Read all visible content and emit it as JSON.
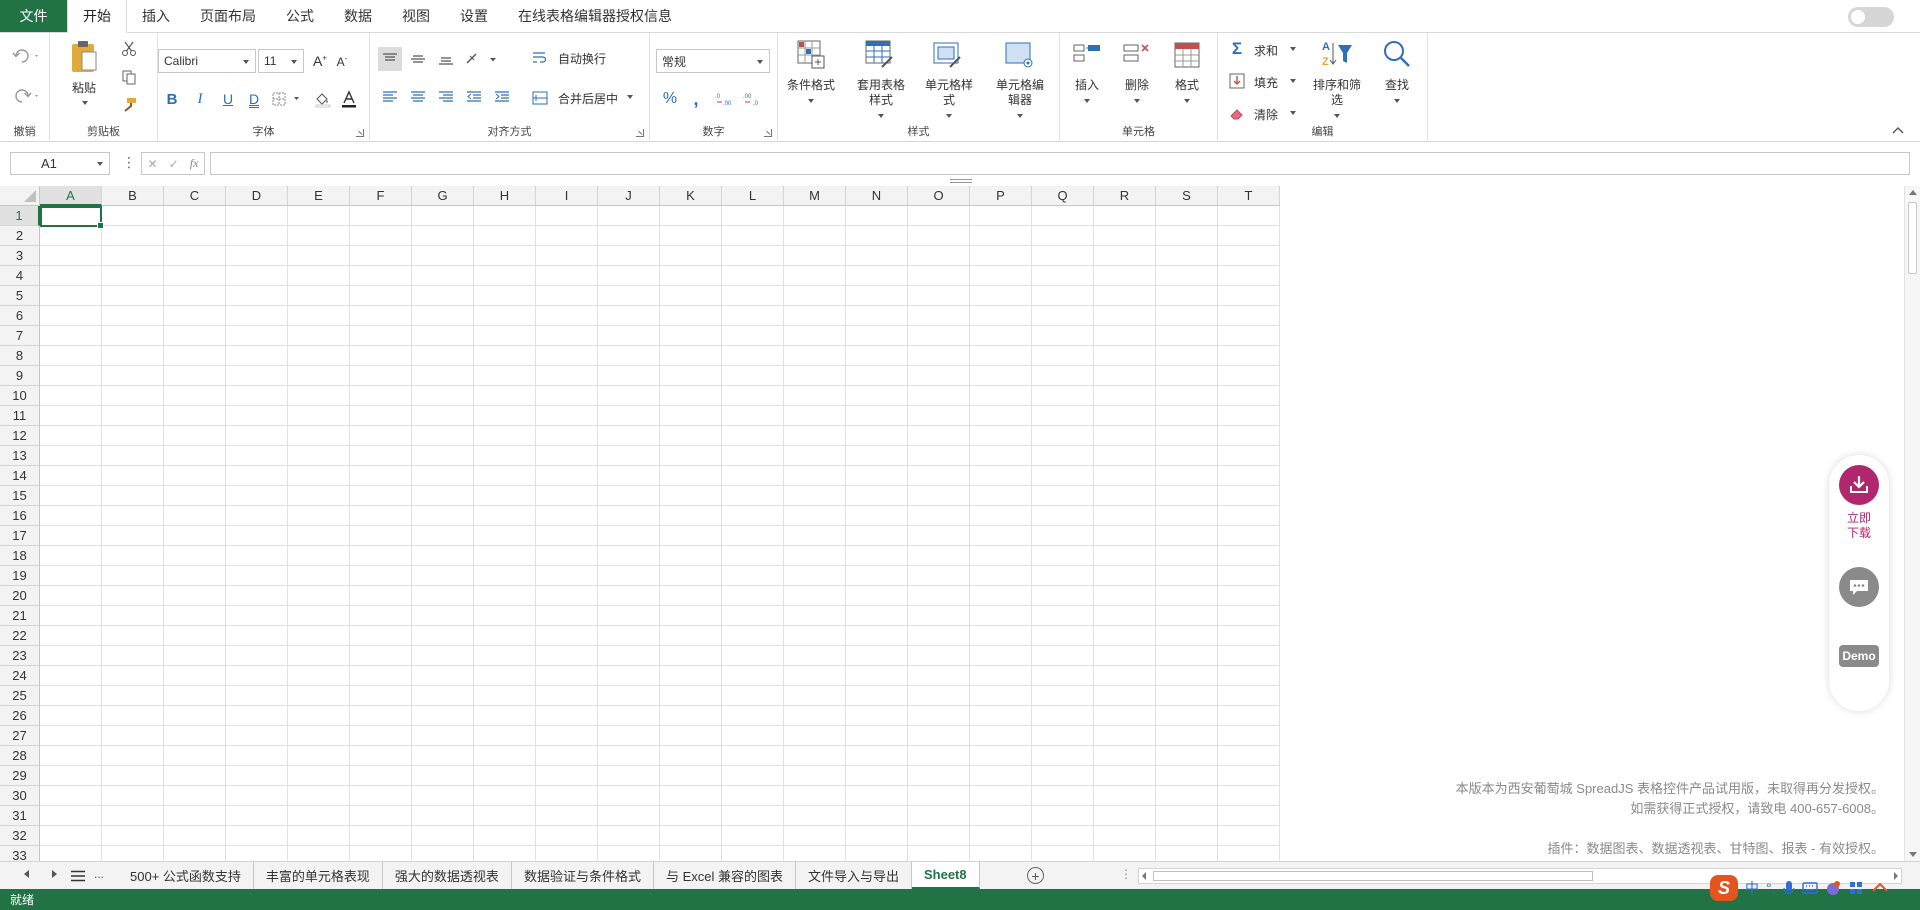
{
  "menu": {
    "file": "文件",
    "tabs": [
      "开始",
      "插入",
      "页面布局",
      "公式",
      "数据",
      "视图",
      "设置",
      "在线表格编辑器授权信息"
    ]
  },
  "ribbon": {
    "groups": {
      "undo": "撤销",
      "clipboard": "剪贴板",
      "font": "字体",
      "alignment": "对齐方式",
      "number": "数字",
      "styles": "样式",
      "cells": "单元格",
      "editing": "编辑"
    },
    "paste": "粘贴",
    "font_name": "Calibri",
    "font_size": "11",
    "wrap_text": "自动换行",
    "merge_center": "合并后居中",
    "number_format": "常规",
    "conditional_format": "条件格式",
    "table_style": [
      "套用表格",
      "样式"
    ],
    "cell_style": [
      "单元格样",
      "式"
    ],
    "cell_editor": [
      "单元格编",
      "辑器"
    ],
    "insert": "插入",
    "delete": "删除",
    "format": "格式",
    "sum": "求和",
    "fill": "填充",
    "clear": "清除",
    "sort_filter": [
      "排序和筛",
      "选"
    ],
    "find": "查找"
  },
  "formula_bar": {
    "name_box": "A1",
    "fx": "fx",
    "value": ""
  },
  "grid": {
    "columns": [
      "A",
      "B",
      "C",
      "D",
      "E",
      "F",
      "G",
      "H",
      "I",
      "J",
      "K",
      "L",
      "M",
      "N",
      "O",
      "P",
      "Q",
      "R",
      "S",
      "T"
    ],
    "rows": [
      "1",
      "2",
      "3",
      "4",
      "5",
      "6",
      "7",
      "8",
      "9",
      "10",
      "11",
      "12",
      "13",
      "14",
      "15",
      "16",
      "17",
      "18",
      "19",
      "20",
      "21",
      "22",
      "23",
      "24",
      "25",
      "26",
      "27",
      "28",
      "29",
      "30",
      "31",
      "32",
      "33"
    ],
    "selected_column": "A",
    "selected_row": "1"
  },
  "watermark": {
    "line1": "本版本为西安葡萄城 SpreadJS 表格控件产品试用版，未取得再分发授权。",
    "line2": "如需获得正式授权，请致电 400-657-6008。",
    "line3": "插件：数据图表、数据透视表、甘特图、报表 - 有效授权。"
  },
  "side_widget": {
    "download": [
      "立即",
      "下载"
    ],
    "demo": "Demo"
  },
  "sheets": {
    "tabs": [
      "500+ 公式函数支持",
      "丰富的单元格表现",
      "强大的数据透视表",
      "数据验证与条件格式",
      "与 Excel 兼容的图表",
      "文件导入与导出",
      "Sheet8"
    ],
    "active_index": 6,
    "more": "..."
  },
  "status": {
    "text": "就绪"
  },
  "ime": {
    "lang": "中",
    "punct": "°,"
  },
  "colors": {
    "accent": "#217346",
    "download": "#b0276f"
  }
}
